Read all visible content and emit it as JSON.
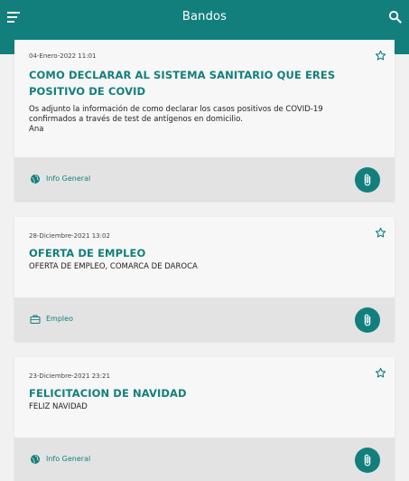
{
  "appbar": {
    "title": "Bandos",
    "menu_icon": "menu-icon",
    "search_icon": "search-icon"
  },
  "colors": {
    "primary": "#127f7d",
    "footer": "#e3e3e3",
    "card": "#f7f7f7"
  },
  "posts": [
    {
      "date": "04-Enero-2022 11:01",
      "title": "COMO DECLARAR  AL SISTEMA SANITARIO QUE ERES POSITIVO DE COVID",
      "description": "Os adjunto la información de como declarar los casos positivos de COVID-19\nconfirmados a través de test de antígenos en domicilio.\nAna",
      "category": "Info General",
      "category_icon": "globe-icon"
    },
    {
      "date": "28-Diciembre-2021 13:02",
      "title": "OFERTA DE EMPLEO",
      "description": "OFERTA DE EMPLEO, COMARCA DE DAROCA",
      "category": "Empleo",
      "category_icon": "briefcase-icon"
    },
    {
      "date": "23-Diciembre-2021 23:21",
      "title": "FELICITACION DE NAVIDAD",
      "description": "FELIZ NAVIDAD",
      "category": "Info General",
      "category_icon": "globe-icon"
    }
  ]
}
